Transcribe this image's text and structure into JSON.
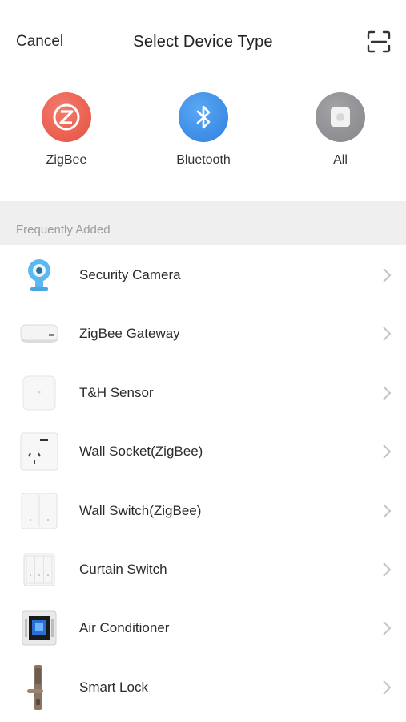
{
  "header": {
    "cancel_label": "Cancel",
    "title": "Select Device Type",
    "scan_icon": "scan-icon"
  },
  "device_types": [
    {
      "label": "ZigBee",
      "icon": "zigbee-icon",
      "color": "#e85a49"
    },
    {
      "label": "Bluetooth",
      "icon": "bluetooth-icon",
      "color": "#3d8de8"
    },
    {
      "label": "All",
      "icon": "all-devices-icon",
      "color": "#8e8e93"
    }
  ],
  "section": {
    "title": "Frequently Added"
  },
  "devices": [
    {
      "name": "Security Camera",
      "icon": "security-camera-icon"
    },
    {
      "name": "ZigBee Gateway",
      "icon": "zigbee-gateway-icon"
    },
    {
      "name": "T&H Sensor",
      "icon": "th-sensor-icon"
    },
    {
      "name": "Wall Socket(ZigBee)",
      "icon": "wall-socket-icon"
    },
    {
      "name": "Wall Switch(ZigBee)",
      "icon": "wall-switch-icon"
    },
    {
      "name": "Curtain Switch",
      "icon": "curtain-switch-icon"
    },
    {
      "name": "Air Conditioner",
      "icon": "air-conditioner-icon"
    },
    {
      "name": "Smart Lock",
      "icon": "smart-lock-icon"
    }
  ]
}
